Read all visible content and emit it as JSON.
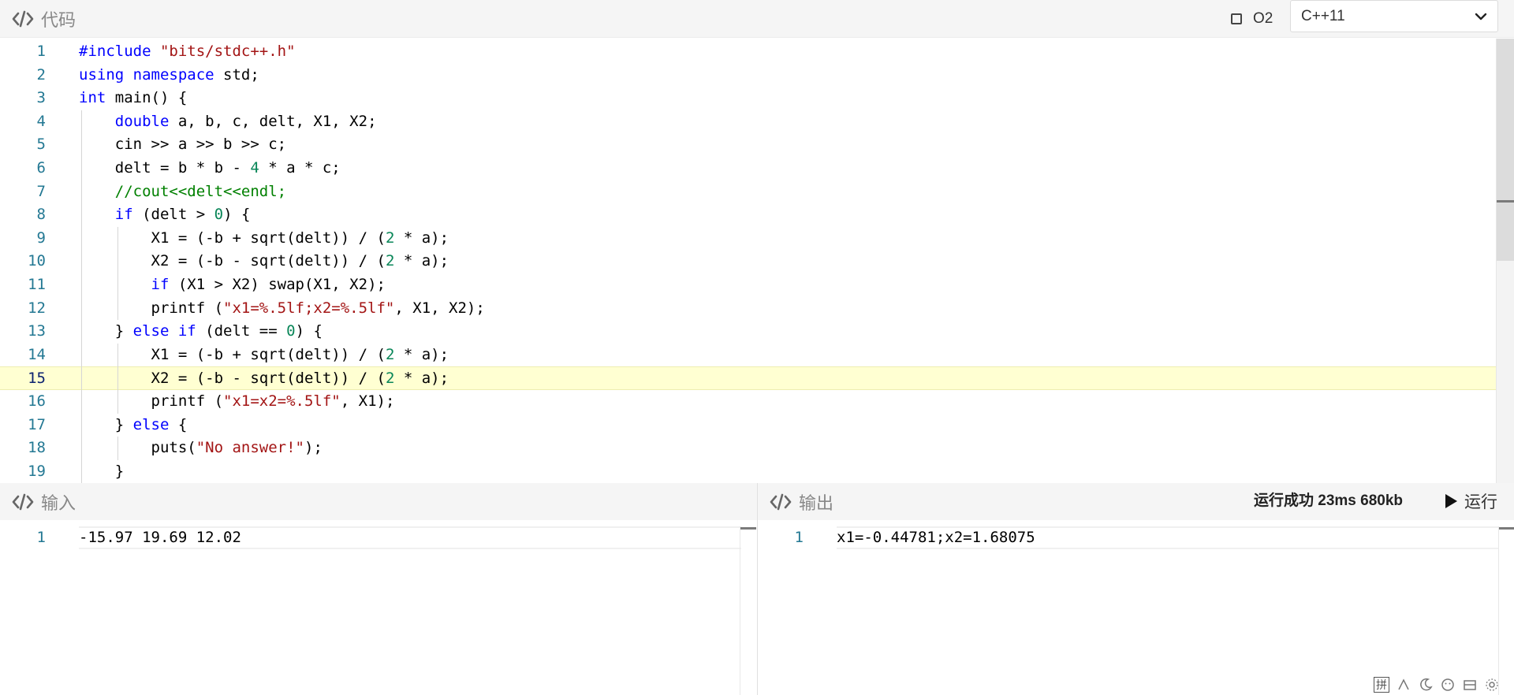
{
  "code_panel": {
    "tab_label": "代码",
    "o2_label": "O2",
    "language": "C++11",
    "current_line": 15,
    "lines": [
      {
        "n": "1",
        "tokens": [
          {
            "c": "pp",
            "t": "#include "
          },
          {
            "c": "str",
            "t": "\"bits/stdc++.h\""
          }
        ]
      },
      {
        "n": "2",
        "tokens": [
          {
            "c": "kw",
            "t": "using namespace"
          },
          {
            "c": "",
            "t": " std;"
          }
        ]
      },
      {
        "n": "3",
        "tokens": [
          {
            "c": "kw",
            "t": "int"
          },
          {
            "c": "",
            "t": " main() {"
          }
        ]
      },
      {
        "n": "4",
        "tokens": [
          {
            "c": "",
            "t": "    "
          },
          {
            "c": "kw",
            "t": "double"
          },
          {
            "c": "",
            "t": " a, b, c, delt, X1, X2;"
          }
        ]
      },
      {
        "n": "5",
        "tokens": [
          {
            "c": "",
            "t": "    cin >> a >> b >> c;"
          }
        ]
      },
      {
        "n": "6",
        "tokens": [
          {
            "c": "",
            "t": "    delt = b * b - "
          },
          {
            "c": "num",
            "t": "4"
          },
          {
            "c": "",
            "t": " * a * c;"
          }
        ]
      },
      {
        "n": "7",
        "tokens": [
          {
            "c": "",
            "t": "    "
          },
          {
            "c": "cmt",
            "t": "//cout<<delt<<endl;"
          }
        ]
      },
      {
        "n": "8",
        "tokens": [
          {
            "c": "",
            "t": "    "
          },
          {
            "c": "kw",
            "t": "if"
          },
          {
            "c": "",
            "t": " (delt > "
          },
          {
            "c": "num",
            "t": "0"
          },
          {
            "c": "",
            "t": ") {"
          }
        ]
      },
      {
        "n": "9",
        "tokens": [
          {
            "c": "",
            "t": "        X1 = (-b + sqrt(delt)) / ("
          },
          {
            "c": "num",
            "t": "2"
          },
          {
            "c": "",
            "t": " * a);"
          }
        ]
      },
      {
        "n": "10",
        "tokens": [
          {
            "c": "",
            "t": "        X2 = (-b - sqrt(delt)) / ("
          },
          {
            "c": "num",
            "t": "2"
          },
          {
            "c": "",
            "t": " * a);"
          }
        ]
      },
      {
        "n": "11",
        "tokens": [
          {
            "c": "",
            "t": "        "
          },
          {
            "c": "kw",
            "t": "if"
          },
          {
            "c": "",
            "t": " (X1 > X2) swap(X1, X2);"
          }
        ]
      },
      {
        "n": "12",
        "tokens": [
          {
            "c": "",
            "t": "        printf ("
          },
          {
            "c": "str",
            "t": "\"x1=%.5lf;x2=%.5lf\""
          },
          {
            "c": "",
            "t": ", X1, X2);"
          }
        ]
      },
      {
        "n": "13",
        "tokens": [
          {
            "c": "",
            "t": "    } "
          },
          {
            "c": "kw",
            "t": "else if"
          },
          {
            "c": "",
            "t": " (delt == "
          },
          {
            "c": "num",
            "t": "0"
          },
          {
            "c": "",
            "t": ") {"
          }
        ]
      },
      {
        "n": "14",
        "tokens": [
          {
            "c": "",
            "t": "        X1 = (-b + sqrt(delt)) / ("
          },
          {
            "c": "num",
            "t": "2"
          },
          {
            "c": "",
            "t": " * a);"
          }
        ]
      },
      {
        "n": "15",
        "tokens": [
          {
            "c": "",
            "t": "        X2 = (-b - sqrt(delt)) / ("
          },
          {
            "c": "num",
            "t": "2"
          },
          {
            "c": "",
            "t": " * a);"
          }
        ]
      },
      {
        "n": "16",
        "tokens": [
          {
            "c": "",
            "t": "        printf ("
          },
          {
            "c": "str",
            "t": "\"x1=x2=%.5lf\""
          },
          {
            "c": "",
            "t": ", X1);"
          }
        ]
      },
      {
        "n": "17",
        "tokens": [
          {
            "c": "",
            "t": "    } "
          },
          {
            "c": "kw",
            "t": "else"
          },
          {
            "c": "",
            "t": " {"
          }
        ]
      },
      {
        "n": "18",
        "tokens": [
          {
            "c": "",
            "t": "        puts("
          },
          {
            "c": "str",
            "t": "\"No answer!\""
          },
          {
            "c": "",
            "t": ");"
          }
        ]
      },
      {
        "n": "19",
        "tokens": [
          {
            "c": "",
            "t": "    }"
          }
        ]
      }
    ]
  },
  "input_panel": {
    "tab_label": "输入",
    "line_number": "1",
    "value": "-15.97 19.69 12.02"
  },
  "output_panel": {
    "tab_label": "输出",
    "status": "运行成功 23ms 680kb",
    "run_label": "运行",
    "line_number": "1",
    "value": "x1=-0.44781;x2=1.68075"
  },
  "ime": {
    "label": "拼"
  },
  "icons": {
    "code": "code-brackets-icon",
    "checkbox": "checkbox-icon",
    "dropdown": "chevron-down-icon",
    "run": "play-icon"
  },
  "colors": {
    "keyword": "#0000ff",
    "number": "#098658",
    "string": "#a31515",
    "comment": "#008000",
    "line_number": "#237893",
    "current_line_bg": "#ffffd2",
    "panel_header_bg": "#f5f5f5"
  }
}
